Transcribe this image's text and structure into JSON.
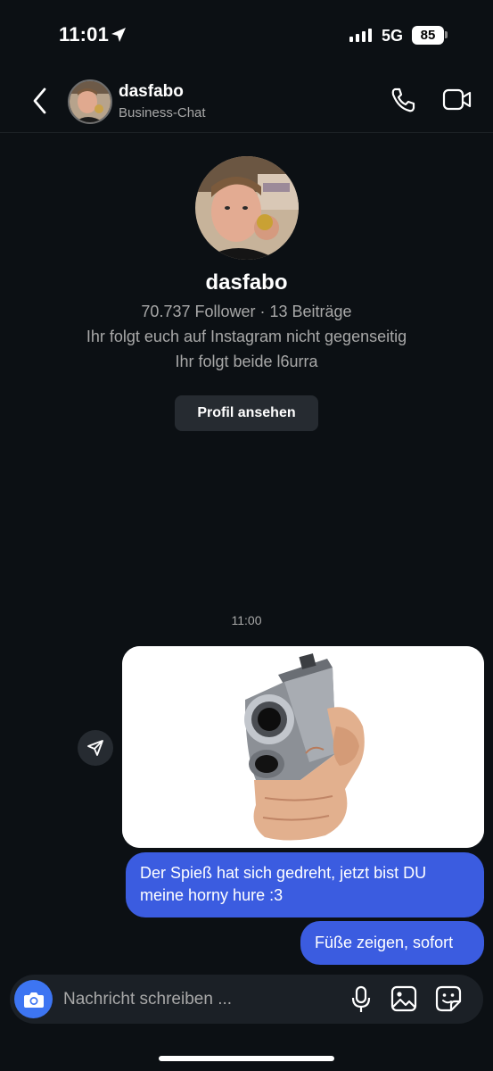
{
  "status_bar": {
    "time": "11:01",
    "network": "5G",
    "battery": "85"
  },
  "header": {
    "username": "dasfabo",
    "subtitle": "Business-Chat"
  },
  "profile_card": {
    "username": "dasfabo",
    "stats": "70.737 Follower · 13 Beiträge",
    "follow_status": "Ihr folgt euch auf Instagram nicht gegenseitig",
    "mutual": "Ihr folgt beide l6urra",
    "view_profile_label": "Profil ansehen"
  },
  "thread": {
    "timestamp": "11:00",
    "messages": [
      {
        "type": "image",
        "icon": "pistol-image"
      },
      {
        "type": "text",
        "text": "Der Spieß hat sich gedreht, jetzt bist DU meine horny hure :3"
      },
      {
        "type": "text",
        "text": "Füße zeigen, sofort"
      }
    ]
  },
  "composer": {
    "placeholder": "Nachricht schreiben ..."
  },
  "colors": {
    "background": "#0c1014",
    "bubble": "#3b5ce0",
    "camera": "#3d75f2",
    "button": "#262b31"
  }
}
